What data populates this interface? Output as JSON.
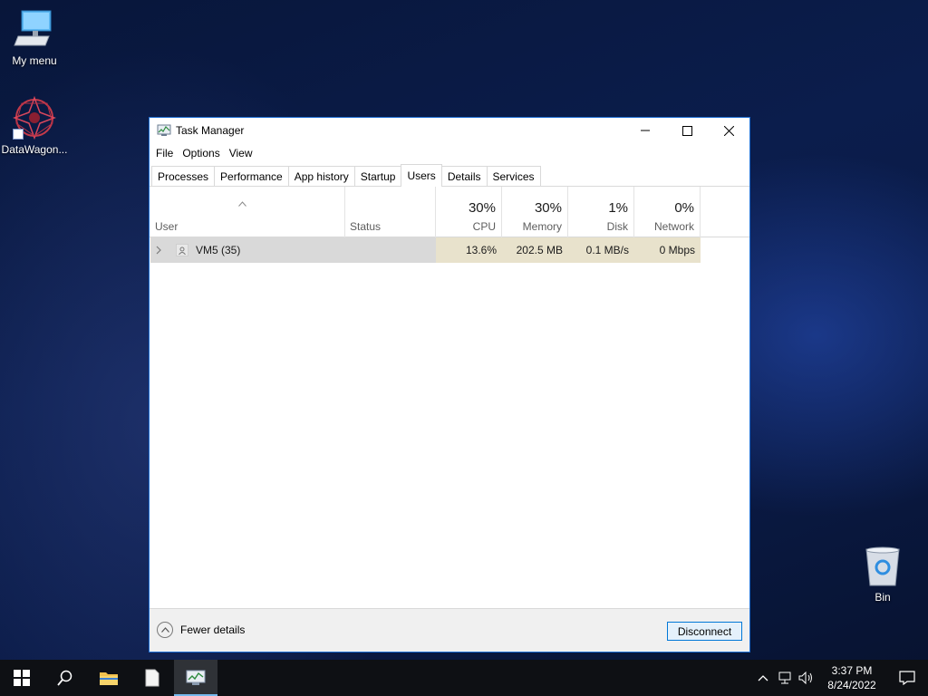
{
  "desktop": {
    "icons": [
      {
        "label": "My menu"
      },
      {
        "label": "DataWagon..."
      },
      {
        "label": "Bin"
      }
    ]
  },
  "window": {
    "title": "Task Manager",
    "menu": [
      "File",
      "Options",
      "View"
    ],
    "tabs": [
      "Processes",
      "Performance",
      "App history",
      "Startup",
      "Users",
      "Details",
      "Services"
    ],
    "active_tab": "Users",
    "columns": {
      "user": {
        "name": "User"
      },
      "status": {
        "name": "Status"
      },
      "cpu": {
        "pct": "30%",
        "name": "CPU"
      },
      "memory": {
        "pct": "30%",
        "name": "Memory"
      },
      "disk": {
        "pct": "1%",
        "name": "Disk"
      },
      "network": {
        "pct": "0%",
        "name": "Network"
      }
    },
    "rows": [
      {
        "user": "VM5 (35)",
        "status": "",
        "cpu": "13.6%",
        "memory": "202.5 MB",
        "disk": "0.1 MB/s",
        "network": "0 Mbps"
      }
    ],
    "footer": {
      "fewer_details": "Fewer details",
      "disconnect": "Disconnect"
    }
  },
  "taskbar": {
    "time": "3:37 PM",
    "date": "8/24/2022"
  },
  "colors": {
    "accent": "#0078d7",
    "selected_row": "#d9d9d9",
    "cpu_heat": "#e8e2cc"
  }
}
